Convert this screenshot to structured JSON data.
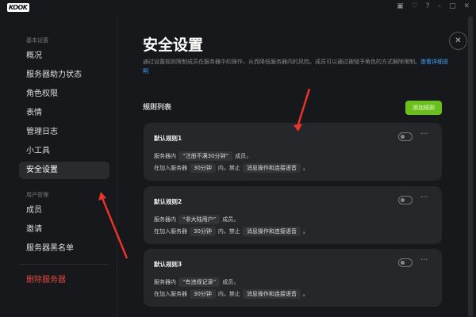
{
  "app": {
    "logo": "KOOK",
    "window_controls": [
      "minimize",
      "maximize",
      "close"
    ]
  },
  "sidebar": {
    "section_basic": "基本设置",
    "items": [
      {
        "label": "概况"
      },
      {
        "label": "服务器助力状态"
      },
      {
        "label": "角色权限"
      },
      {
        "label": "表情"
      },
      {
        "label": "管理日志"
      },
      {
        "label": "小工具"
      },
      {
        "label": "安全设置",
        "active": true
      }
    ],
    "section_users": "用户管理",
    "user_items": [
      {
        "label": "成员"
      },
      {
        "label": "邀请"
      },
      {
        "label": "服务器黑名单"
      }
    ],
    "delete_label": "删除服务器"
  },
  "main": {
    "title": "安全设置",
    "description": "通过设置规则限制成员在服务器中的操作，从而降低服务器内的风险。成员可以通过被赋予角色的方式解除限制。",
    "link": "查看详细说明",
    "list_title": "规则列表",
    "add_button": "添加规则",
    "rules": [
      {
        "name": "默认规则1",
        "pre": "服务器内",
        "cond": "“注册不满30分钟”",
        "post": "成员，",
        "l2a": "在加入服务器",
        "time": "30分钟",
        "l2b": "内，禁止",
        "action": "消息操作和连接语音",
        "end": "。",
        "enabled": false
      },
      {
        "name": "默认规则2",
        "pre": "服务器内",
        "cond": "“非大陆用户”",
        "post": "成员，",
        "l2a": "在加入服务器",
        "time": "30分钟",
        "l2b": "内，禁止",
        "action": "消息操作和连接语音",
        "end": "。",
        "enabled": false
      },
      {
        "name": "默认规则3",
        "pre": "服务器内",
        "cond": "“有违规记录”",
        "post": "成员，",
        "l2a": "在加入服务器",
        "time": "30分钟",
        "l2b": "内，禁止",
        "action": "消息操作和连接语音",
        "end": "。",
        "enabled": false
      }
    ]
  },
  "colors": {
    "accent": "#6bbf1a",
    "danger": "#e0463f",
    "link": "#3ea7ff",
    "annotation": "#e8322b"
  }
}
